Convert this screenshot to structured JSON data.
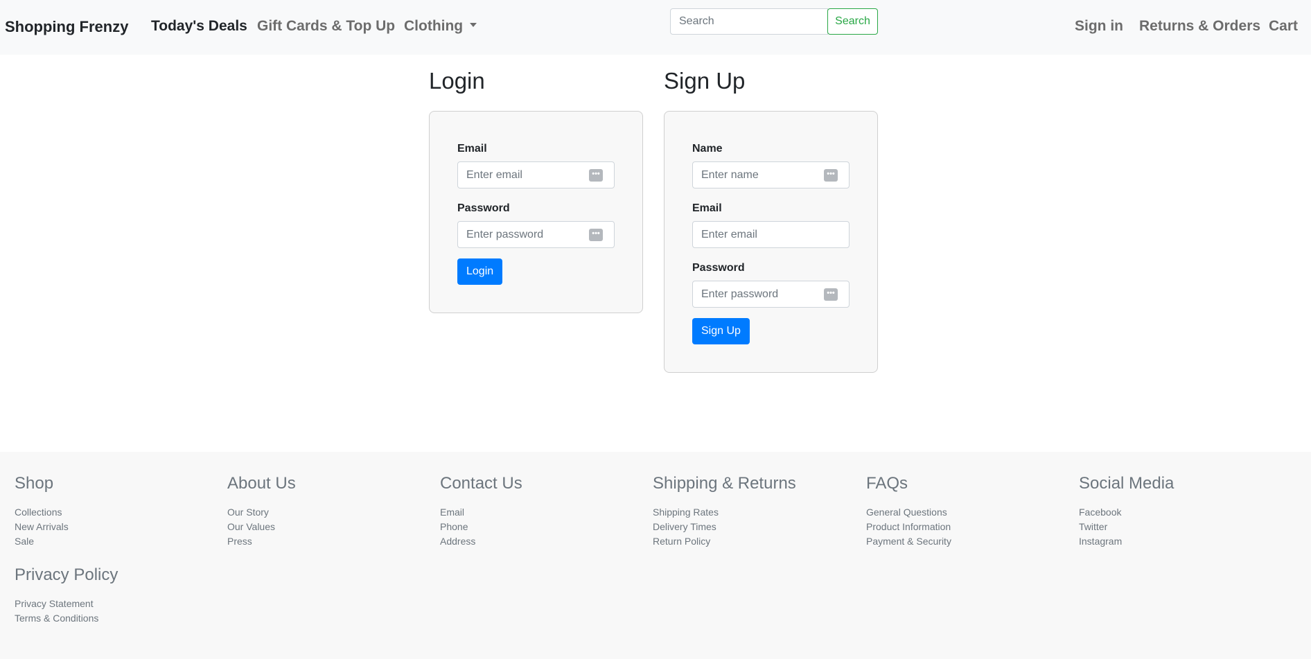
{
  "navbar": {
    "brand": "Shopping Frenzy",
    "links": [
      "Today's Deals",
      "Gift Cards & Top Up",
      "Clothing"
    ],
    "search_placeholder": "Search",
    "search_button": "Search",
    "right_links": [
      "Sign in",
      "Returns & Orders",
      "Cart"
    ]
  },
  "login": {
    "title": "Login",
    "email_label": "Email",
    "email_placeholder": "Enter email",
    "password_label": "Password",
    "password_placeholder": "Enter password",
    "button": "Login"
  },
  "signup": {
    "title": "Sign Up",
    "name_label": "Name",
    "name_placeholder": "Enter name",
    "email_label": "Email",
    "email_placeholder": "Enter email",
    "password_label": "Password",
    "password_placeholder": "Enter password",
    "button": "Sign Up"
  },
  "footer": {
    "columns": [
      {
        "title": "Shop",
        "links": [
          "Collections",
          "New Arrivals",
          "Sale"
        ]
      },
      {
        "title": "About Us",
        "links": [
          "Our Story",
          "Our Values",
          "Press"
        ]
      },
      {
        "title": "Contact Us",
        "links": [
          "Email",
          "Phone",
          "Address"
        ]
      },
      {
        "title": "Shipping & Returns",
        "links": [
          "Shipping Rates",
          "Delivery Times",
          "Return Policy"
        ]
      },
      {
        "title": "FAQs",
        "links": [
          "General Questions",
          "Product Information",
          "Payment & Security"
        ]
      },
      {
        "title": "Social Media",
        "links": [
          "Facebook",
          "Twitter",
          "Instagram"
        ]
      },
      {
        "title": "Privacy Policy",
        "links": [
          "Privacy Statement",
          "Terms & Conditions"
        ]
      }
    ]
  },
  "icons": {
    "password_manager": "password-key-icon",
    "dropdown": "caret-down-icon"
  },
  "colors": {
    "primary": "#007bff",
    "success": "#28a745",
    "navbar_bg": "#f8f9fa",
    "footer_bg": "#f8f8f8"
  }
}
